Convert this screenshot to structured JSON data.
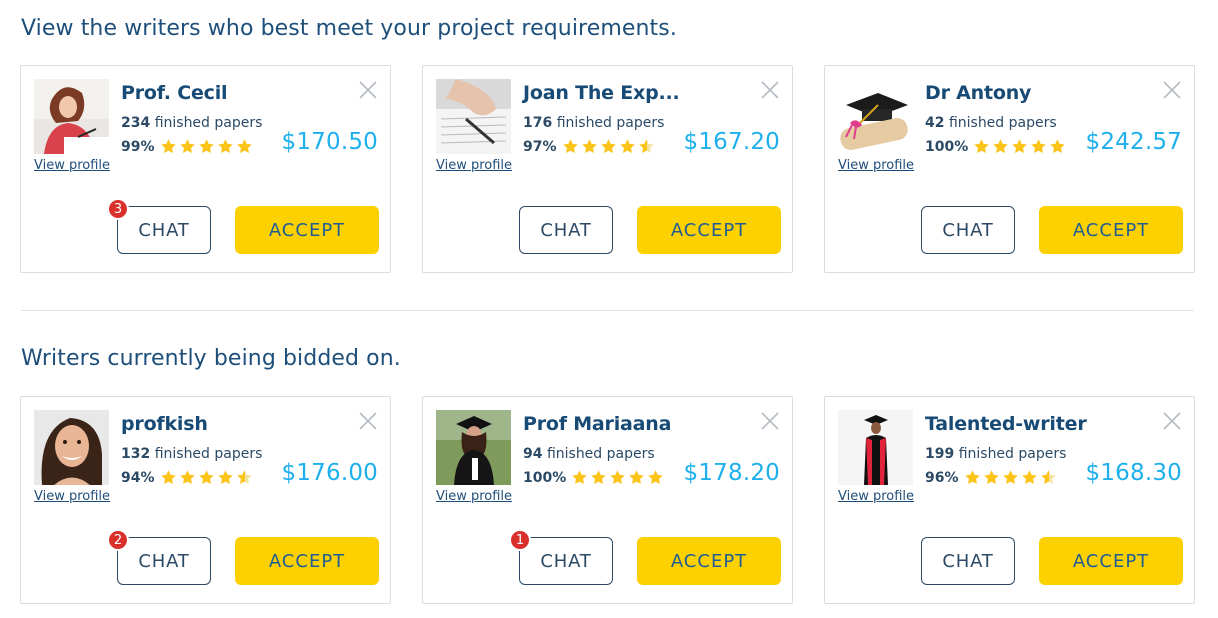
{
  "sections": [
    {
      "title": "View the writers who best meet your project requirements.",
      "writers": [
        {
          "name": "Prof. Cecil",
          "papers": "234",
          "papers_label": "finished papers",
          "rating": "99%",
          "stars": 5,
          "price": "$170.50",
          "view_profile": "View profile",
          "chat": "CHAT",
          "accept": "ACCEPT",
          "badge": "3",
          "avatar": "woman-writing-photo"
        },
        {
          "name": "Joan The Exp...",
          "papers": "176",
          "papers_label": "finished papers",
          "rating": "97%",
          "stars": 4.5,
          "price": "$167.20",
          "view_profile": "View profile",
          "chat": "CHAT",
          "accept": "ACCEPT",
          "badge": "",
          "avatar": "hand-writing-photo"
        },
        {
          "name": "Dr Antony",
          "papers": "42",
          "papers_label": "finished papers",
          "rating": "100%",
          "stars": 5,
          "price": "$242.57",
          "view_profile": "View profile",
          "chat": "CHAT",
          "accept": "ACCEPT",
          "badge": "",
          "avatar": "graduation-cap-photo"
        }
      ]
    },
    {
      "title": "Writers currently being bidded on.",
      "writers": [
        {
          "name": "profkish",
          "papers": "132",
          "papers_label": "finished papers",
          "rating": "94%",
          "stars": 4.5,
          "price": "$176.00",
          "view_profile": "View profile",
          "chat": "CHAT",
          "accept": "ACCEPT",
          "badge": "2",
          "avatar": "smiling-woman-photo"
        },
        {
          "name": "Prof Mariaana",
          "papers": "94",
          "papers_label": "finished papers",
          "rating": "100%",
          "stars": 5,
          "price": "$178.20",
          "view_profile": "View profile",
          "chat": "CHAT",
          "accept": "ACCEPT",
          "badge": "1",
          "avatar": "graduate-woman-photo"
        },
        {
          "name": "Talented-writer",
          "papers": "199",
          "papers_label": "finished papers",
          "rating": "96%",
          "stars": 4.5,
          "price": "$168.30",
          "view_profile": "View profile",
          "chat": "CHAT",
          "accept": "ACCEPT",
          "badge": "",
          "avatar": "graduate-gown-photo"
        }
      ]
    }
  ],
  "colors": {
    "accent_price": "#1eb0ec",
    "accept_button": "#fdd000",
    "badge": "#d9302c",
    "star": "#fcc419",
    "heading": "#1d4f7a"
  }
}
